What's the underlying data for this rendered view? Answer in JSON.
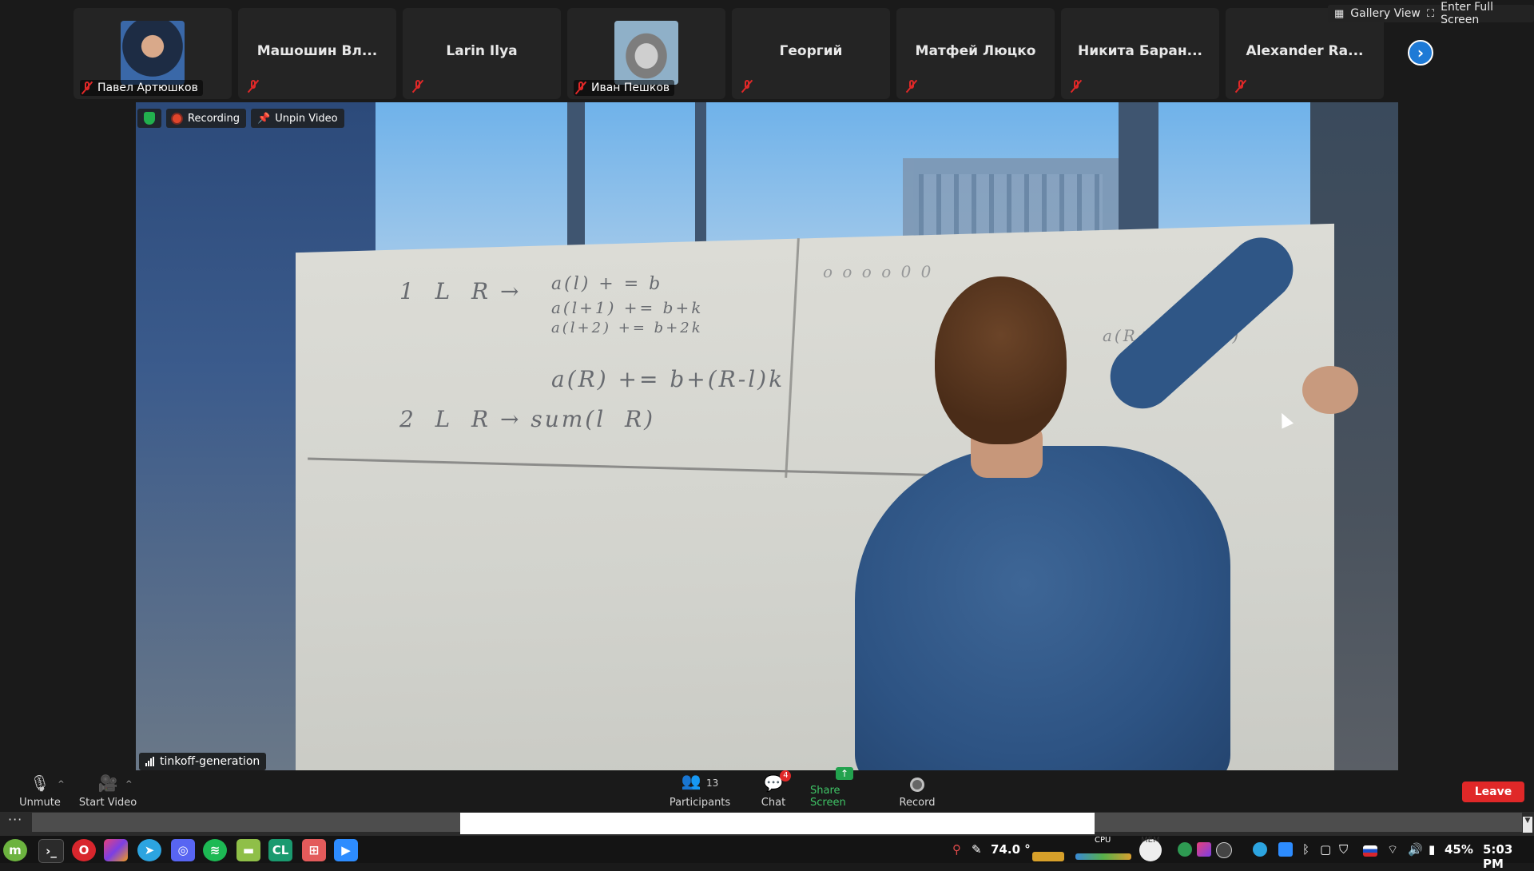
{
  "participants": [
    {
      "name": "Павел Артюшков",
      "has_image": true
    },
    {
      "name": "Машошин Вл...",
      "has_image": false
    },
    {
      "name": "Larin Ilya",
      "has_image": false
    },
    {
      "name": "Иван Пешков",
      "has_image": true
    },
    {
      "name": "Георгий",
      "has_image": false
    },
    {
      "name": "Матфей Люцко",
      "has_image": false
    },
    {
      "name": "Никита Баран...",
      "has_image": false
    },
    {
      "name": "Alexander Ra...",
      "has_image": false
    }
  ],
  "top_controls": {
    "gallery_view": "Gallery View",
    "full_screen": "Enter Full Screen"
  },
  "video": {
    "recording_label": "Recording",
    "unpin_label": "Unpin Video",
    "speaker_name": "tinkoff-generation"
  },
  "toolbar": {
    "unmute": "Unmute",
    "start_video": "Start Video",
    "participants": "Participants",
    "participants_count": "13",
    "chat": "Chat",
    "chat_badge": "4",
    "share_screen": "Share Screen",
    "record": "Record",
    "leave": "Leave"
  },
  "taskbar": {
    "temperature": "74.0 °",
    "cpu_label": "CPU",
    "mem_label": "MEM",
    "battery": "45%",
    "clock": "5:03 PM"
  },
  "colors": {
    "leave": "#e02828",
    "share": "#22a24e",
    "accent": "#1e7ad6"
  }
}
